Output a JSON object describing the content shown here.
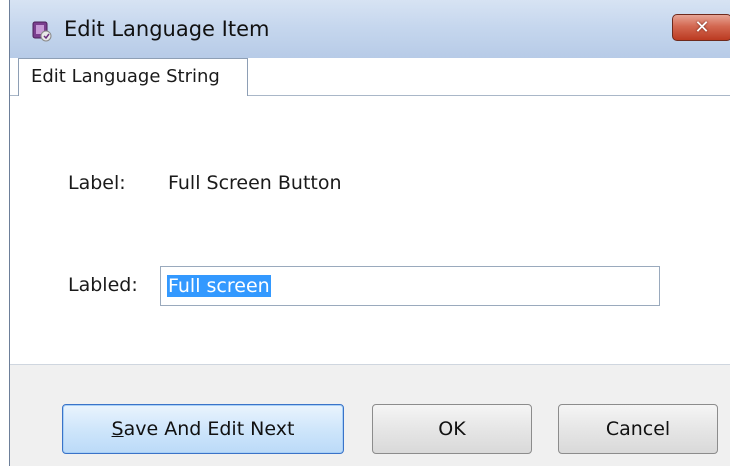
{
  "window": {
    "title": "Edit Language Item",
    "close_icon": "close-icon"
  },
  "tabs": [
    {
      "label": "Edit Language String",
      "selected": true
    }
  ],
  "form": {
    "label_caption": "Label:",
    "label_value": "Full Screen Button",
    "labeled_caption": "Labled:",
    "labeled_value": "Full screen"
  },
  "buttons": {
    "save_next_mnemonic": "S",
    "save_next_rest": "ave And Edit Next",
    "ok": "OK",
    "cancel": "Cancel"
  },
  "colors": {
    "selection": "#3399ff",
    "default_button_border": "#3a73c8",
    "close_button": "#c9513a"
  }
}
